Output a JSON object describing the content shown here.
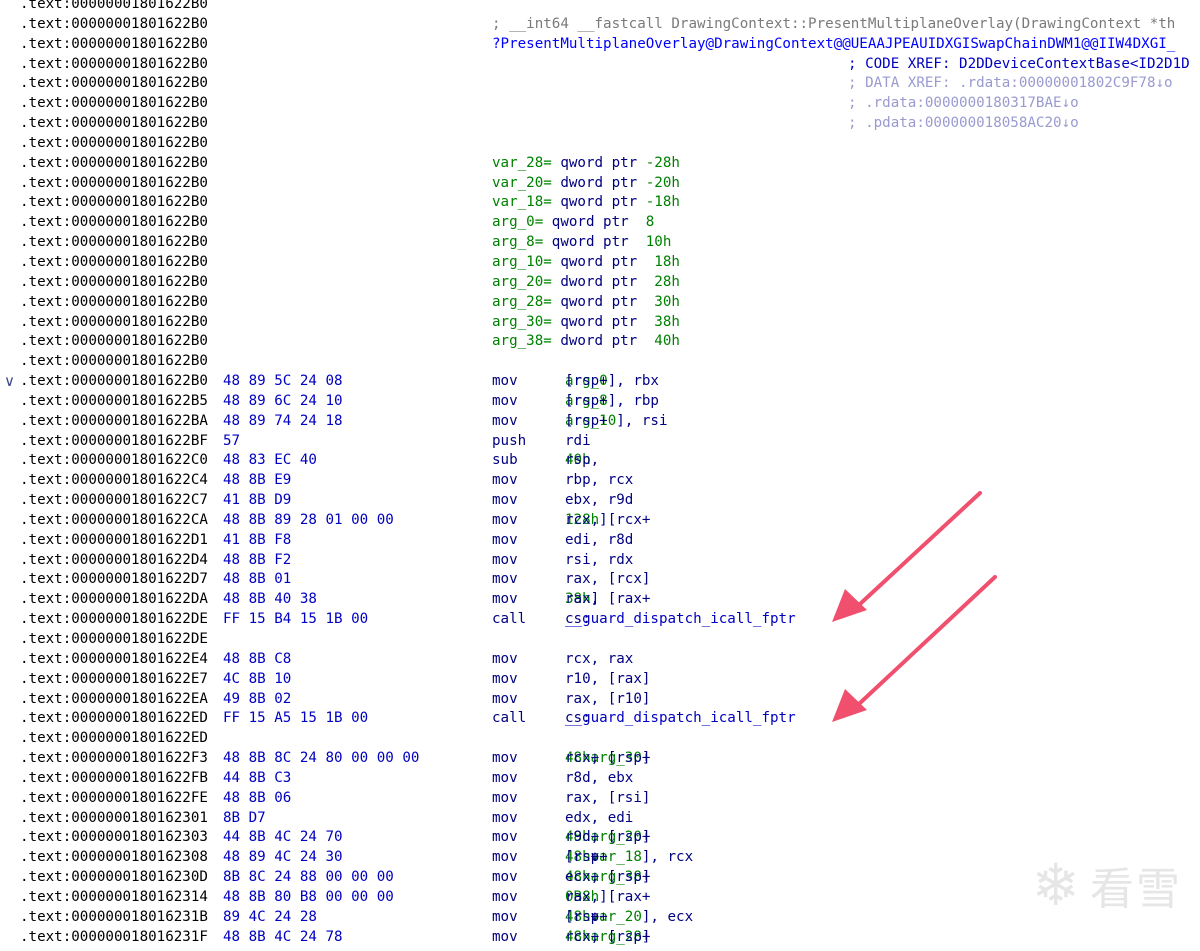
{
  "collapse_glyph": "∨",
  "listing": [
    {
      "addr": ".text:00000001801622B0"
    },
    {
      "addr": ".text:00000001801622B0",
      "kind": "cmt",
      "text": "; __int64 __fastcall DrawingContext::PresentMultiplaneOverlay(DrawingContext *th"
    },
    {
      "addr": ".text:00000001801622B0",
      "kind": "sym",
      "text": "?PresentMultiplaneOverlay@DrawingContext@@UEAAJPEAUIDXGISwapChainDWM1@@IIW4DXGI_"
    },
    {
      "addr": ".text:00000001801622B0",
      "kind": "xref1",
      "text": "; CODE XREF: D2DDeviceContextBase<ID2D1D"
    },
    {
      "addr": ".text:00000001801622B0",
      "kind": "xref",
      "text": "; DATA XREF: .rdata:00000001802C9F78↓o"
    },
    {
      "addr": ".text:00000001801622B0",
      "kind": "xref",
      "text": "; .rdata:0000000180317BAE↓o"
    },
    {
      "addr": ".text:00000001801622B0",
      "kind": "xref",
      "text": "; .pdata:000000018058AC20↓o"
    },
    {
      "addr": ".text:00000001801622B0"
    },
    {
      "addr": ".text:00000001801622B0",
      "kind": "decl",
      "name": "var_28=",
      "type": "qword ptr",
      "val": "-28h"
    },
    {
      "addr": ".text:00000001801622B0",
      "kind": "decl",
      "name": "var_20=",
      "type": "dword ptr",
      "val": "-20h"
    },
    {
      "addr": ".text:00000001801622B0",
      "kind": "decl",
      "name": "var_18=",
      "type": "qword ptr",
      "val": "-18h"
    },
    {
      "addr": ".text:00000001801622B0",
      "kind": "decl",
      "name": "arg_0=",
      "type": "qword ptr",
      "val": " 8"
    },
    {
      "addr": ".text:00000001801622B0",
      "kind": "decl",
      "name": "arg_8=",
      "type": "qword ptr",
      "val": " 10h"
    },
    {
      "addr": ".text:00000001801622B0",
      "kind": "decl",
      "name": "arg_10=",
      "type": "qword ptr",
      "val": " 18h"
    },
    {
      "addr": ".text:00000001801622B0",
      "kind": "decl",
      "name": "arg_20=",
      "type": "dword ptr",
      "val": " 28h"
    },
    {
      "addr": ".text:00000001801622B0",
      "kind": "decl",
      "name": "arg_28=",
      "type": "qword ptr",
      "val": " 30h"
    },
    {
      "addr": ".text:00000001801622B0",
      "kind": "decl",
      "name": "arg_30=",
      "type": "qword ptr",
      "val": " 38h"
    },
    {
      "addr": ".text:00000001801622B0",
      "kind": "decl",
      "name": "arg_38=",
      "type": "dword ptr",
      "val": " 40h"
    },
    {
      "addr": ".text:00000001801622B0"
    },
    {
      "addr": ".text:00000001801622B0",
      "collapse": true,
      "bytes": "48 89 5C 24 08",
      "mn": "mov",
      "ops": [
        [
          "t",
          "[rsp+"
        ],
        [
          "v",
          "arg_0"
        ],
        [
          "t",
          "], rbx"
        ]
      ]
    },
    {
      "addr": ".text:00000001801622B5",
      "bytes": "48 89 6C 24 10",
      "mn": "mov",
      "ops": [
        [
          "t",
          "[rsp+"
        ],
        [
          "v",
          "arg_8"
        ],
        [
          "t",
          "], rbp"
        ]
      ]
    },
    {
      "addr": ".text:00000001801622BA",
      "bytes": "48 89 74 24 18",
      "mn": "mov",
      "ops": [
        [
          "t",
          "[rsp+"
        ],
        [
          "v",
          "arg_10"
        ],
        [
          "t",
          "], rsi"
        ]
      ]
    },
    {
      "addr": ".text:00000001801622BF",
      "bytes": "57",
      "mn": "push",
      "ops": [
        [
          "t",
          "rdi"
        ]
      ]
    },
    {
      "addr": ".text:00000001801622C0",
      "bytes": "48 83 EC 40",
      "mn": "sub",
      "ops": [
        [
          "t",
          "rsp, "
        ],
        [
          "n",
          "40h"
        ]
      ]
    },
    {
      "addr": ".text:00000001801622C4",
      "bytes": "48 8B E9",
      "mn": "mov",
      "ops": [
        [
          "t",
          "rbp, rcx"
        ]
      ]
    },
    {
      "addr": ".text:00000001801622C7",
      "bytes": "41 8B D9",
      "mn": "mov",
      "ops": [
        [
          "t",
          "ebx, r9d"
        ]
      ]
    },
    {
      "addr": ".text:00000001801622CA",
      "bytes": "48 8B 89 28 01 00 00",
      "mn": "mov",
      "ops": [
        [
          "t",
          "rcx, [rcx+"
        ],
        [
          "n",
          "128h"
        ],
        [
          "t",
          "]"
        ]
      ]
    },
    {
      "addr": ".text:00000001801622D1",
      "bytes": "41 8B F8",
      "mn": "mov",
      "ops": [
        [
          "t",
          "edi, r8d"
        ]
      ]
    },
    {
      "addr": ".text:00000001801622D4",
      "bytes": "48 8B F2",
      "mn": "mov",
      "ops": [
        [
          "t",
          "rsi, rdx"
        ]
      ]
    },
    {
      "addr": ".text:00000001801622D7",
      "bytes": "48 8B 01",
      "mn": "mov",
      "ops": [
        [
          "t",
          "rax, [rcx]"
        ]
      ]
    },
    {
      "addr": ".text:00000001801622DA",
      "bytes": "48 8B 40 38",
      "mn": "mov",
      "ops": [
        [
          "t",
          "rax, [rax+"
        ],
        [
          "n",
          "38h"
        ],
        [
          "t",
          "]"
        ]
      ]
    },
    {
      "addr": ".text:00000001801622DE",
      "bytes": "FF 15 B4 15 1B 00",
      "mn": "call",
      "ops": [
        [
          "t",
          "cs:"
        ],
        [
          "f",
          "__guard_dispatch_icall_fptr"
        ]
      ]
    },
    {
      "addr": ".text:00000001801622DE"
    },
    {
      "addr": ".text:00000001801622E4",
      "bytes": "48 8B C8",
      "mn": "mov",
      "ops": [
        [
          "t",
          "rcx, rax"
        ]
      ]
    },
    {
      "addr": ".text:00000001801622E7",
      "bytes": "4C 8B 10",
      "mn": "mov",
      "ops": [
        [
          "t",
          "r10, [rax]"
        ]
      ]
    },
    {
      "addr": ".text:00000001801622EA",
      "bytes": "49 8B 02",
      "mn": "mov",
      "ops": [
        [
          "t",
          "rax, [r10]"
        ]
      ]
    },
    {
      "addr": ".text:00000001801622ED",
      "bytes": "FF 15 A5 15 1B 00",
      "mn": "call",
      "ops": [
        [
          "t",
          "cs:"
        ],
        [
          "f",
          "__guard_dispatch_icall_fptr"
        ]
      ]
    },
    {
      "addr": ".text:00000001801622ED"
    },
    {
      "addr": ".text:00000001801622F3",
      "bytes": "48 8B 8C 24 80 00 00 00",
      "mn": "mov",
      "ops": [
        [
          "t",
          "rcx, [rsp+"
        ],
        [
          "n",
          "48h"
        ],
        [
          "t",
          "+"
        ],
        [
          "v",
          "arg_30"
        ],
        [
          "t",
          "]"
        ]
      ]
    },
    {
      "addr": ".text:00000001801622FB",
      "bytes": "44 8B C3",
      "mn": "mov",
      "ops": [
        [
          "t",
          "r8d, ebx"
        ]
      ]
    },
    {
      "addr": ".text:00000001801622FE",
      "bytes": "48 8B 06",
      "mn": "mov",
      "ops": [
        [
          "t",
          "rax, [rsi]"
        ]
      ]
    },
    {
      "addr": ".text:0000000180162301",
      "bytes": "8B D7",
      "mn": "mov",
      "ops": [
        [
          "t",
          "edx, edi"
        ]
      ]
    },
    {
      "addr": ".text:0000000180162303",
      "bytes": "44 8B 4C 24 70",
      "mn": "mov",
      "ops": [
        [
          "t",
          "r9d, [rsp+"
        ],
        [
          "n",
          "48h"
        ],
        [
          "t",
          "+"
        ],
        [
          "v",
          "arg_20"
        ],
        [
          "t",
          "]"
        ]
      ]
    },
    {
      "addr": ".text:0000000180162308",
      "bytes": "48 89 4C 24 30",
      "mn": "mov",
      "ops": [
        [
          "t",
          "[rsp+"
        ],
        [
          "n",
          "48h"
        ],
        [
          "t",
          "+"
        ],
        [
          "v",
          "var_18"
        ],
        [
          "t",
          "], rcx"
        ]
      ]
    },
    {
      "addr": ".text:000000018016230D",
      "bytes": "8B 8C 24 88 00 00 00",
      "mn": "mov",
      "ops": [
        [
          "t",
          "ecx, [rsp+"
        ],
        [
          "n",
          "48h"
        ],
        [
          "t",
          "+"
        ],
        [
          "v",
          "arg_38"
        ],
        [
          "t",
          "]"
        ]
      ]
    },
    {
      "addr": ".text:0000000180162314",
      "bytes": "48 8B 80 B8 00 00 00",
      "mn": "mov",
      "ops": [
        [
          "t",
          "rax, [rax+"
        ],
        [
          "n",
          "0B8h"
        ],
        [
          "t",
          "]"
        ]
      ]
    },
    {
      "addr": ".text:000000018016231B",
      "bytes": "89 4C 24 28",
      "mn": "mov",
      "ops": [
        [
          "t",
          "[rsp+"
        ],
        [
          "n",
          "48h"
        ],
        [
          "t",
          "+"
        ],
        [
          "v",
          "var_20"
        ],
        [
          "t",
          "], ecx"
        ]
      ]
    },
    {
      "addr": ".text:000000018016231F",
      "bytes": "48 8B 4C 24 78",
      "mn": "mov",
      "ops": [
        [
          "t",
          "rcx, [rsp+"
        ],
        [
          "n",
          "48h"
        ],
        [
          "t",
          "+"
        ],
        [
          "v",
          "arg_28"
        ],
        [
          "t",
          "]"
        ]
      ]
    }
  ],
  "watermark": {
    "text": "看雪",
    "icon": "snowflake-icon",
    "glyph": "❄"
  },
  "colors": {
    "address": "#000000",
    "bytes": "#0000c0",
    "mnemonic": "#000080",
    "number": "#008000",
    "comment": "#7a7a7a",
    "arrow": "#f0506e"
  }
}
